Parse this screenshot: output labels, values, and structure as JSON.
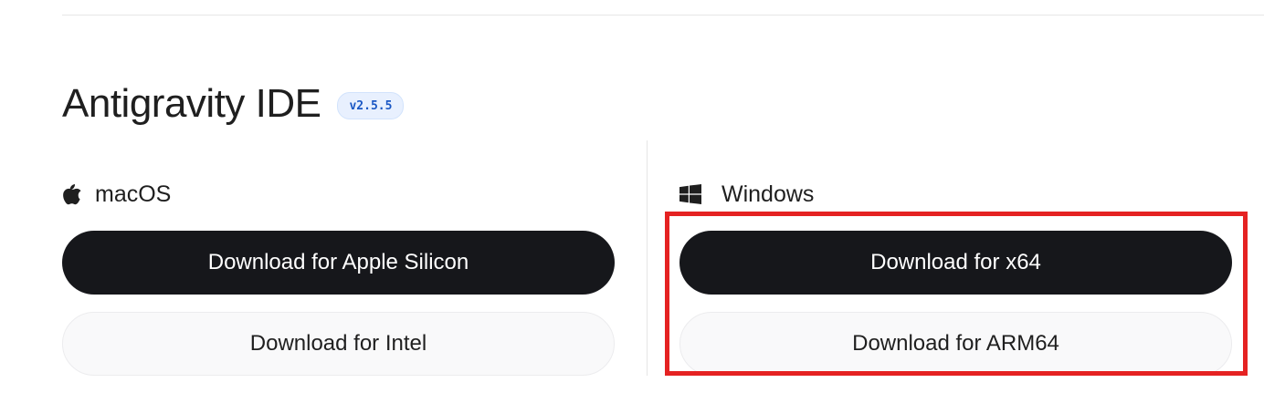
{
  "product": {
    "title": "Antigravity IDE",
    "version": "v2.5.5"
  },
  "platforms": {
    "macos": {
      "label": "macOS",
      "icon": "apple-icon",
      "primary_button": "Download for Apple Silicon",
      "secondary_button": "Download for Intel"
    },
    "windows": {
      "label": "Windows",
      "icon": "windows-icon",
      "primary_button": "Download for x64",
      "secondary_button": "Download for ARM64"
    }
  },
  "colors": {
    "primary_button_bg": "#16171b",
    "secondary_button_bg": "#f9f9fa",
    "badge_text": "#1a57c4",
    "highlight": "#e52222"
  }
}
